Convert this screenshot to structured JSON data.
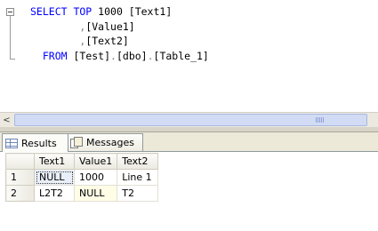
{
  "editor": {
    "lines": [
      {
        "keyword": "SELECT TOP",
        "rest": " 1000 [Text1]"
      },
      {
        "punct": ",",
        "rest": "[Value1]"
      },
      {
        "punct": ",",
        "rest": "[Text2]"
      },
      {
        "keyword": "FROM",
        "rest": " [Test]",
        "punct1": ".",
        "rest2": "[dbo]",
        "punct2": ".",
        "rest3": "[Table_1]"
      }
    ]
  },
  "scrollbar": {
    "left_arrow": "<"
  },
  "tabs": [
    {
      "label": "Results",
      "icon": "grid-icon",
      "active": true
    },
    {
      "label": "Messages",
      "icon": "messages-icon",
      "active": false
    }
  ],
  "results": {
    "columns": [
      "Text1",
      "Value1",
      "Text2"
    ],
    "rows": [
      {
        "num": "1",
        "cells": [
          "NULL",
          "1000",
          "Line 1"
        ]
      },
      {
        "num": "2",
        "cells": [
          "L2T2",
          "NULL",
          "T2"
        ]
      }
    ]
  }
}
